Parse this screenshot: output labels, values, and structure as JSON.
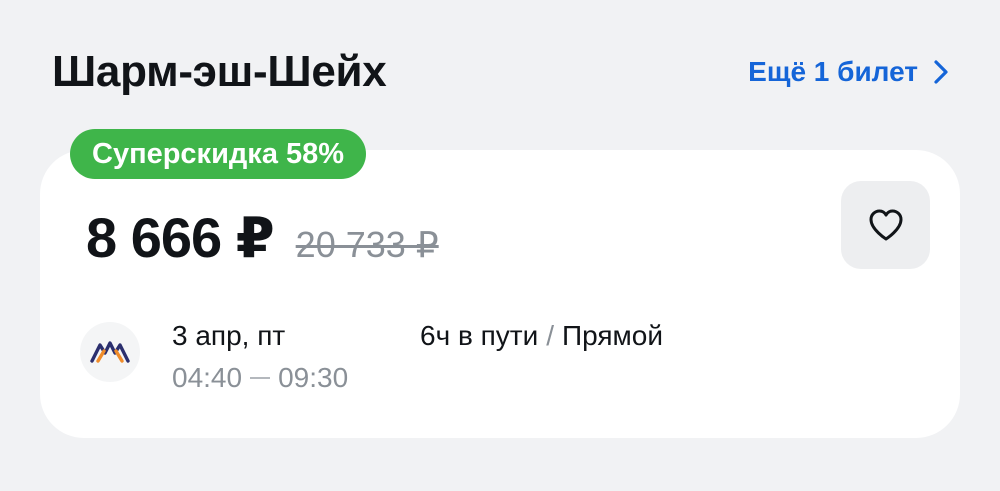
{
  "header": {
    "title": "Шарм-эш-Шейх",
    "more_label": "Ещё 1 билет"
  },
  "ticket": {
    "badge": "Суперскидка 58%",
    "price": "8 666 ₽",
    "old_price": "20 733 ₽",
    "date": "3 апр, пт",
    "departure_time": "04:40",
    "arrival_time": "09:30",
    "duration": "6ч в пути",
    "stops": "Прямой"
  },
  "icons": {
    "more": "chevron-right-icon",
    "favorite": "heart-icon",
    "airline": "airline-logo-icon"
  },
  "colors": {
    "accent_link": "#1565d8",
    "badge_green": "#3fb54a",
    "muted_text": "#8a9097",
    "logo_navy": "#2b2f6e",
    "logo_orange": "#f08c2a"
  }
}
